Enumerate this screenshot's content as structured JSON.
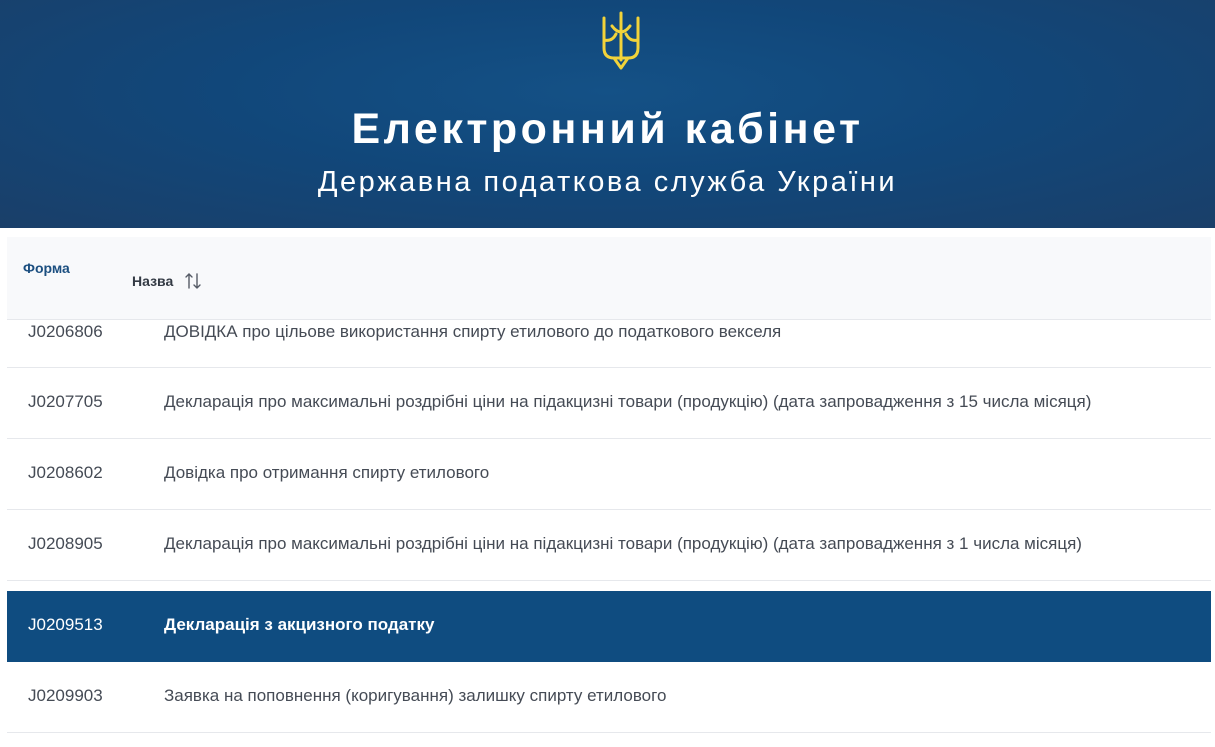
{
  "header": {
    "emblem_icon": "trident-icon",
    "emblem_color": "#f2d33a",
    "title": "Електронний кабінет",
    "subtitle": "Державна податкова служба України"
  },
  "table": {
    "columns": {
      "form": "Форма",
      "name": "Назва",
      "sort_icon": "sort-arrows-icon"
    },
    "rows": [
      {
        "code": "J0206806",
        "name": "ДОВІДКА про цільове використання спирту етилового до податкового векселя",
        "selected": false
      },
      {
        "code": "J0207705",
        "name": "Декларація про максимальні роздрібні ціни на підакцизні товари (продукцію) (дата запровадження з 15 числа місяця)",
        "selected": false
      },
      {
        "code": "J0208602",
        "name": "Довідка про отримання спирту етилового",
        "selected": false
      },
      {
        "code": "J0208905",
        "name": "Декларація про максимальні роздрібні ціни на підакцизні товари (продукцію) (дата запровадження з 1 числа місяця)",
        "selected": false
      },
      {
        "code": "J0209513",
        "name": "Декларація з акцизного податку",
        "selected": true
      },
      {
        "code": "J0209903",
        "name": "Заявка на поповнення (коригування) залишку спирту етилового",
        "selected": false
      }
    ],
    "selected_color": "#0f4c80"
  }
}
